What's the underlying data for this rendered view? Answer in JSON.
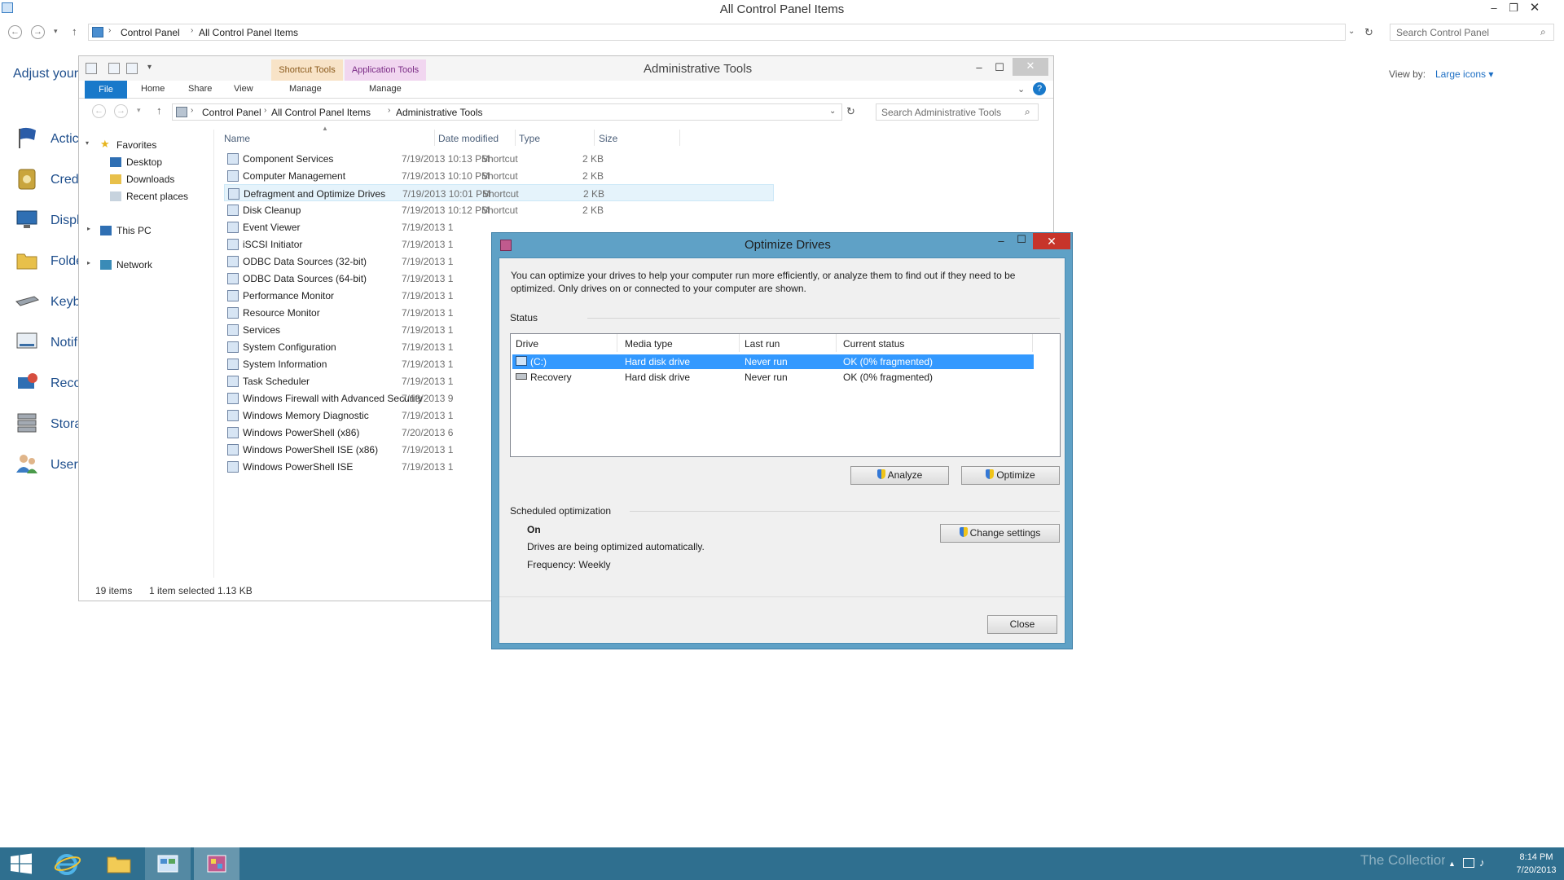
{
  "cp": {
    "title": "All Control Panel Items",
    "breadcrumb": [
      "Control Panel",
      "All Control Panel Items"
    ],
    "search_placeholder": "Search Control Panel",
    "adjust_label": "Adjust your",
    "viewby_label": "View by:",
    "viewby_value": "Large icons",
    "items": [
      "Actic",
      "Cred",
      "Displ",
      "Folde",
      "Keyb",
      "Notifi",
      "Reco",
      "Stora",
      "User"
    ]
  },
  "explorer": {
    "title": "Administrative Tools",
    "tool_tabs": [
      "Shortcut Tools",
      "Application Tools"
    ],
    "ribbon": {
      "file": "File",
      "home": "Home",
      "share": "Share",
      "view": "View",
      "manage1": "Manage",
      "manage2": "Manage"
    },
    "breadcrumb": [
      "Control Panel",
      "All Control Panel Items",
      "Administrative Tools"
    ],
    "search_placeholder": "Search Administrative Tools",
    "sidebar": {
      "favorites": "Favorites",
      "desktop": "Desktop",
      "downloads": "Downloads",
      "recent": "Recent places",
      "thispc": "This PC",
      "network": "Network"
    },
    "columns": [
      "Name",
      "Date modified",
      "Type",
      "Size"
    ],
    "rows": [
      {
        "name": "Component Services",
        "date": "7/19/2013 10:13 PM",
        "type": "Shortcut",
        "size": "2 KB"
      },
      {
        "name": "Computer Management",
        "date": "7/19/2013 10:10 PM",
        "type": "Shortcut",
        "size": "2 KB"
      },
      {
        "name": "Defragment and Optimize Drives",
        "date": "7/19/2013 10:01 PM",
        "type": "Shortcut",
        "size": "2 KB"
      },
      {
        "name": "Disk Cleanup",
        "date": "7/19/2013 10:12 PM",
        "type": "Shortcut",
        "size": "2 KB"
      },
      {
        "name": "Event Viewer",
        "date": "7/19/2013 1",
        "type": "",
        "size": ""
      },
      {
        "name": "iSCSI Initiator",
        "date": "7/19/2013 1",
        "type": "",
        "size": ""
      },
      {
        "name": "ODBC Data Sources (32-bit)",
        "date": "7/19/2013 1",
        "type": "",
        "size": ""
      },
      {
        "name": "ODBC Data Sources (64-bit)",
        "date": "7/19/2013 1",
        "type": "",
        "size": ""
      },
      {
        "name": "Performance Monitor",
        "date": "7/19/2013 1",
        "type": "",
        "size": ""
      },
      {
        "name": "Resource Monitor",
        "date": "7/19/2013 1",
        "type": "",
        "size": ""
      },
      {
        "name": "Services",
        "date": "7/19/2013 1",
        "type": "",
        "size": ""
      },
      {
        "name": "System Configuration",
        "date": "7/19/2013 1",
        "type": "",
        "size": ""
      },
      {
        "name": "System Information",
        "date": "7/19/2013 1",
        "type": "",
        "size": ""
      },
      {
        "name": "Task Scheduler",
        "date": "7/19/2013 1",
        "type": "",
        "size": ""
      },
      {
        "name": "Windows Firewall with Advanced Security",
        "date": "7/19/2013 9",
        "type": "",
        "size": ""
      },
      {
        "name": "Windows Memory Diagnostic",
        "date": "7/19/2013 1",
        "type": "",
        "size": ""
      },
      {
        "name": "Windows PowerShell (x86)",
        "date": "7/20/2013 6",
        "type": "",
        "size": ""
      },
      {
        "name": "Windows PowerShell ISE (x86)",
        "date": "7/19/2013 1",
        "type": "",
        "size": ""
      },
      {
        "name": "Windows PowerShell ISE",
        "date": "7/19/2013 1",
        "type": "",
        "size": ""
      }
    ],
    "status": {
      "count": "19 items",
      "selected": "1 item selected",
      "size": "1.13 KB"
    }
  },
  "dialog": {
    "title": "Optimize Drives",
    "description": "You can optimize your drives to help your computer run more efficiently, or analyze them to find out if they need to be optimized. Only drives on or connected to your computer are shown.",
    "status_label": "Status",
    "columns": [
      "Drive",
      "Media type",
      "Last run",
      "Current status"
    ],
    "drives": [
      {
        "drive": "(C:)",
        "media": "Hard disk drive",
        "last_run": "Never run",
        "status": "OK (0% fragmented)"
      },
      {
        "drive": "Recovery",
        "media": "Hard disk drive",
        "last_run": "Never run",
        "status": "OK (0% fragmented)"
      }
    ],
    "analyze": "Analyze",
    "optimize": "Optimize",
    "scheduled_label": "Scheduled optimization",
    "sched_state": "On",
    "sched_desc": "Drives are being optimized automatically.",
    "frequency": "Frequency: Weekly",
    "change_settings": "Change settings",
    "close": "Close"
  },
  "taskbar": {
    "time": "8:14 PM",
    "date": "7/20/2013",
    "watermark": "The Collection Book"
  }
}
